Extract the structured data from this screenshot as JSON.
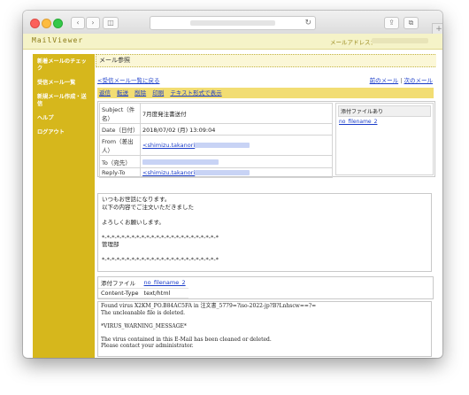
{
  "browser": {
    "back_icon": "chevron-left-icon",
    "forward_icon": "chevron-right-icon",
    "sidebar_icon": "sidebar-icon",
    "reload_icon": "reload-icon",
    "share_icon": "share-icon",
    "tabs_icon": "tabs-icon",
    "new_tab_icon": "plus-icon"
  },
  "app": {
    "logo": "MailViewer",
    "address_label": "メールアドレス："
  },
  "sidebar": {
    "items": [
      {
        "label": "新着メールのチェック"
      },
      {
        "label": "受信メール一覧"
      },
      {
        "label": "新規メール作成・送信"
      },
      {
        "label": "ヘルプ"
      },
      {
        "label": "ログアウト"
      }
    ]
  },
  "main": {
    "title": "メール参照",
    "back_to_list": "<受信メール一覧に戻る",
    "prev_mail": "前のメール",
    "next_mail": "次のメール",
    "separator": "|",
    "actions": [
      "返信",
      "転送",
      "削除",
      "印刷",
      "テキスト形式で表示"
    ],
    "headers": {
      "subject_label": "Subject（件名）",
      "subject_value": "7月度発注書送付",
      "date_label": "Date（日付）",
      "date_value": "2018/07/02 (月) 13:09:04",
      "from_label": "From（差出人）",
      "from_value": "<shimizu.takanori",
      "to_label": "To（宛先）",
      "replyto_label": "Reply-To",
      "replyto_value": "<shimizu.takanori"
    },
    "attachment_side": {
      "header": "添付ファイルあり",
      "filename": "no_filename_2"
    },
    "body_lines": [
      "いつもお世話になります。",
      "以下の内容でご注文いただきました",
      "",
      "よろしくお願いします。",
      "",
      "*-*-*-*-*-*-*-*-*-*-*-*-*-*-*-*-*-*-*-*-*-*-*-*",
      "管理部",
      "",
      "*-*-*-*-*-*-*-*-*-*-*-*-*-*-*-*-*-*-*-*-*-*-*-*"
    ],
    "attachment": {
      "file_label": "添付ファイル",
      "file_value": "no_filename_2",
      "ctype_label": "Content-Type",
      "ctype_value": "text/html"
    },
    "virus_lines": [
      "Found virus X2KM_PO.B84AC5FA in 注文書_5779=?iso-2022-jp?B?Lnhscw==?=",
      "The uncleanable file is deleted.",
      "",
      "*VIRUS_WARNING_MESSAGE*",
      "",
      "The virus contained in this E-Mail has been cleaned or deleted.",
      "Please contact your administrator."
    ]
  }
}
